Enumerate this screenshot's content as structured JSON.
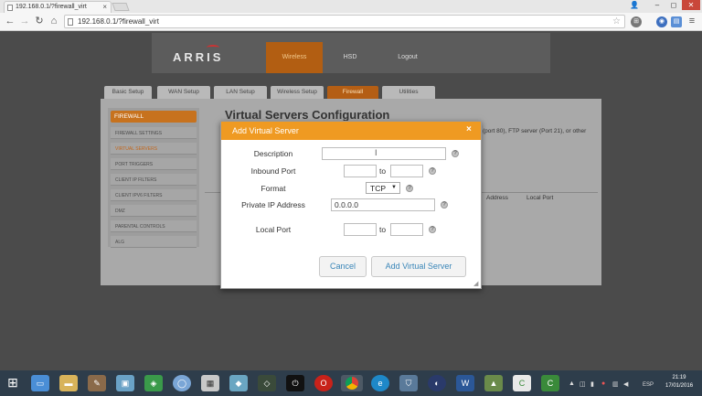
{
  "browser": {
    "tab_title": "192.168.0.1/?firewall_virt",
    "tab_close": "×",
    "url": "192.168.0.1/?firewall_virt",
    "window_controls": [
      "–",
      "◻",
      "✕"
    ],
    "nav_icons": [
      "arrow-left-icon",
      "arrow-right-icon",
      "reload-icon",
      "home-icon"
    ]
  },
  "header": {
    "logo": "ARRIS",
    "nav": [
      "Wireless",
      "HSD",
      "Logout"
    ]
  },
  "tabs": [
    "Basic Setup",
    "WAN Setup",
    "LAN Setup",
    "Wireless Setup",
    "Firewall",
    "Utilities"
  ],
  "sidebar": {
    "heading": "FIREWALL",
    "items": [
      "FIREWALL SETTINGS",
      "VIRTUAL SERVERS",
      "PORT TRIGGERS",
      "CLIENT IP FILTERS",
      "CLIENT IPV6 FILTERS",
      "DMZ",
      "PARENTAL CONTROLS",
      "ALG"
    ]
  },
  "main": {
    "title": "Virtual Servers Configuration",
    "desc_fragment": "(port 80), FTP server (Port 21), or other",
    "col_address": "Address",
    "col_local_port": "Local Port"
  },
  "modal": {
    "title": "Add Virtual Server",
    "close": "×",
    "description_label": "Description",
    "description_value": "",
    "inbound_label": "Inbound Port",
    "inbound_from": "",
    "inbound_to": "",
    "to_label": "to",
    "format_label": "Format",
    "format_value": "TCP",
    "private_ip_label": "Private IP Address",
    "private_ip_value": "0.0.0.0",
    "local_port_label": "Local Port",
    "local_from": "",
    "local_to": "",
    "help": "?",
    "cancel": "Cancel",
    "add": "Add Virtual Server"
  },
  "taskbar": {
    "clock_time": "21:19",
    "clock_date": "17/01/2016",
    "lang": "ESP"
  }
}
